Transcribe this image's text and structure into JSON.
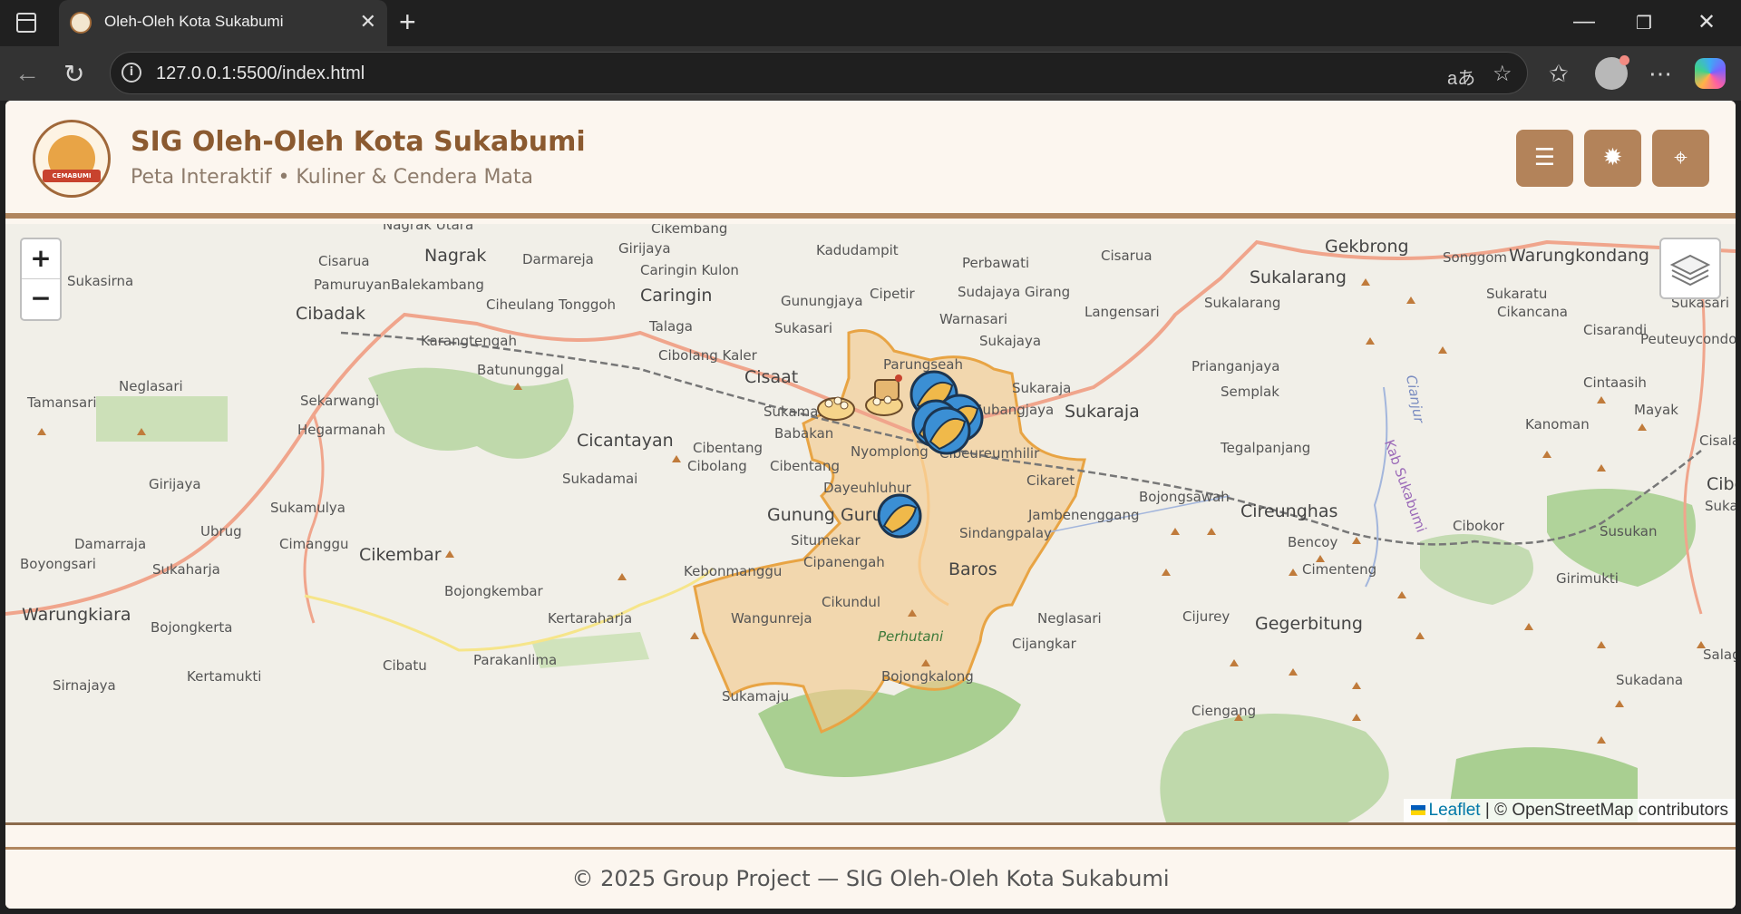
{
  "browser": {
    "tab_title": "Oleh-Oleh Kota Sukabumi",
    "url": "127.0.0.1:5500/index.html"
  },
  "header": {
    "title": "SIG Oleh-Oleh Kota Sukabumi",
    "subtitle": "Peta Interaktif • Kuliner & Cendera Mata",
    "logo_text": "CEMABUMI",
    "buttons": [
      "menu-icon",
      "theme-icon",
      "locate-icon"
    ]
  },
  "map": {
    "zoom_in": "+",
    "zoom_out": "−",
    "attribution_link": "Leaflet",
    "attribution_rest": "| © OpenStreetMap contributors",
    "places": {
      "nagrak_utara": "Nagrak Utara",
      "cikembang": "Cikembang",
      "gekbrong": "Gekbrong",
      "cisarua1": "Cisarua",
      "nagrak": "Nagrak",
      "darmareja": "Darmareja",
      "girijaya1": "Girijaya",
      "kadudampit": "Kadudampit",
      "perbawati": "Perbawati",
      "cisarua2": "Cisarua",
      "songgom": "Songgom",
      "warungkondang": "Warungkondang",
      "sukasirna": "Sukasirna",
      "pamuruyan": "Pamuruyan",
      "balekambang": "Balekambang",
      "caringin_kulon": "Caringin Kulon",
      "caringin": "Caringin",
      "gunungjaya": "Gunungjaya",
      "cipetir": "Cipetir",
      "sudajaya_girang": "Sudajaya Girang",
      "sukalarang_big": "Sukalarang",
      "cibadak": "Cibadak",
      "ciheulang_tonggoh": "Ciheulang Tonggoh",
      "warnasari": "Warnasari",
      "langensari": "Langensari",
      "sukalarang": "Sukalarang",
      "sukaratu": "Sukaratu",
      "sukasari2": "Sukasari",
      "cikancana": "Cikancana",
      "cisarandi": "Cisarandi",
      "karangtengah": "Karangtengah",
      "talaga": "Talaga",
      "sukasari1": "Sukasari",
      "sukajaya": "Sukajaya",
      "peuteuycondong": "Peuteuycondong",
      "cibolang_kaler": "Cibolang Kaler",
      "parungseah": "Parungseah",
      "batununggal": "Batununggal",
      "prianganjaya": "Prianganjaya",
      "neglasari1": "Neglasari",
      "cisaat": "Cisaat",
      "sukaraja_small": "Sukaraja",
      "semplak": "Semplak",
      "cintaasih": "Cintaasih",
      "tamansari": "Tamansari",
      "sekarwangi": "Sekarwangi",
      "subangjaya": "Subangjaya",
      "sukaraja_big": "Sukaraja",
      "sukamanah": "Sukamanah",
      "mayak": "Mayak",
      "hegarmanah": "Hegarmanah",
      "babakan": "Babakan",
      "kanoman": "Kanoman",
      "cicantayan": "Cicantayan",
      "cibentang": "Cibentang",
      "nyomplong": "Nyomplong",
      "cibeureumhilir": "Cibeureumhilir",
      "tegalpanjang": "Tegalpanjang",
      "cisalak": "Cisalak",
      "cibolang": "Cibolang",
      "cibentang2": "Cibentang",
      "cikaret": "Cikaret",
      "girijaya2": "Girijaya",
      "sukadamai": "Sukadamai",
      "dayeuhluhur": "Dayeuhluhur",
      "bojongsawah": "Bojongsawah",
      "cibeber": "Cibeber",
      "cireunghas": "Cireunghas",
      "cibokor": "Cibokor",
      "sukamulya": "Sukamulya",
      "gunung_guruh": "Gunung Guruh",
      "jambenenggang": "Jambenenggang",
      "sukamaju2": "Sukamaju",
      "ubrug": "Ubrug",
      "sindangpalay": "Sindangpalay",
      "bencoy": "Bencoy",
      "susukan": "Susukan",
      "damarraja": "Damarraja",
      "cimanggu": "Cimanggu",
      "situmekar": "Situmekar",
      "cikembar": "Cikembar",
      "cipanengah": "Cipanengah",
      "boyongsari": "Boyongsari",
      "sukaharja": "Sukaharja",
      "kebonmanggu": "Kebonmanggu",
      "baros": "Baros",
      "cimenteng": "Cimenteng",
      "girimukti": "Girimukti",
      "bojongkembar": "Bojongkembar",
      "cikundul": "Cikundul",
      "warungkiara": "Warungkiara",
      "kertaraharja": "Kertaraharja",
      "wangunreja": "Wangunreja",
      "neglasari2": "Neglasari",
      "cijurey": "Cijurey",
      "gegerbitung": "Gegerbitung",
      "bojongkerta": "Bojongkerta",
      "perhutani": "Perhutani",
      "cijangkar": "Cijangkar",
      "kertamukti": "Kertamukti",
      "cibatu": "Cibatu",
      "parakanlima": "Parakanlima",
      "bojongkalong": "Bojongkalong",
      "sukadana": "Sukadana",
      "sirnajaya": "Sirnajaya",
      "sukamaju1": "Sukamaju",
      "ciengang": "Ciengang",
      "cianjur_river": "Cianjur",
      "kab_sukabumi": "Kab Sukabumi",
      "salag": "Salag"
    }
  },
  "footer": {
    "text": "© 2025 Group Project — SIG Oleh-Oleh Kota Sukabumi"
  },
  "colors": {
    "brand_brown": "#8b5a30",
    "button_brown": "#b3835a",
    "page_bg": "#fcf6ef",
    "city_fill": "#f3c98f",
    "city_border": "#e8a444",
    "marker_blue": "#3b8fd4"
  }
}
